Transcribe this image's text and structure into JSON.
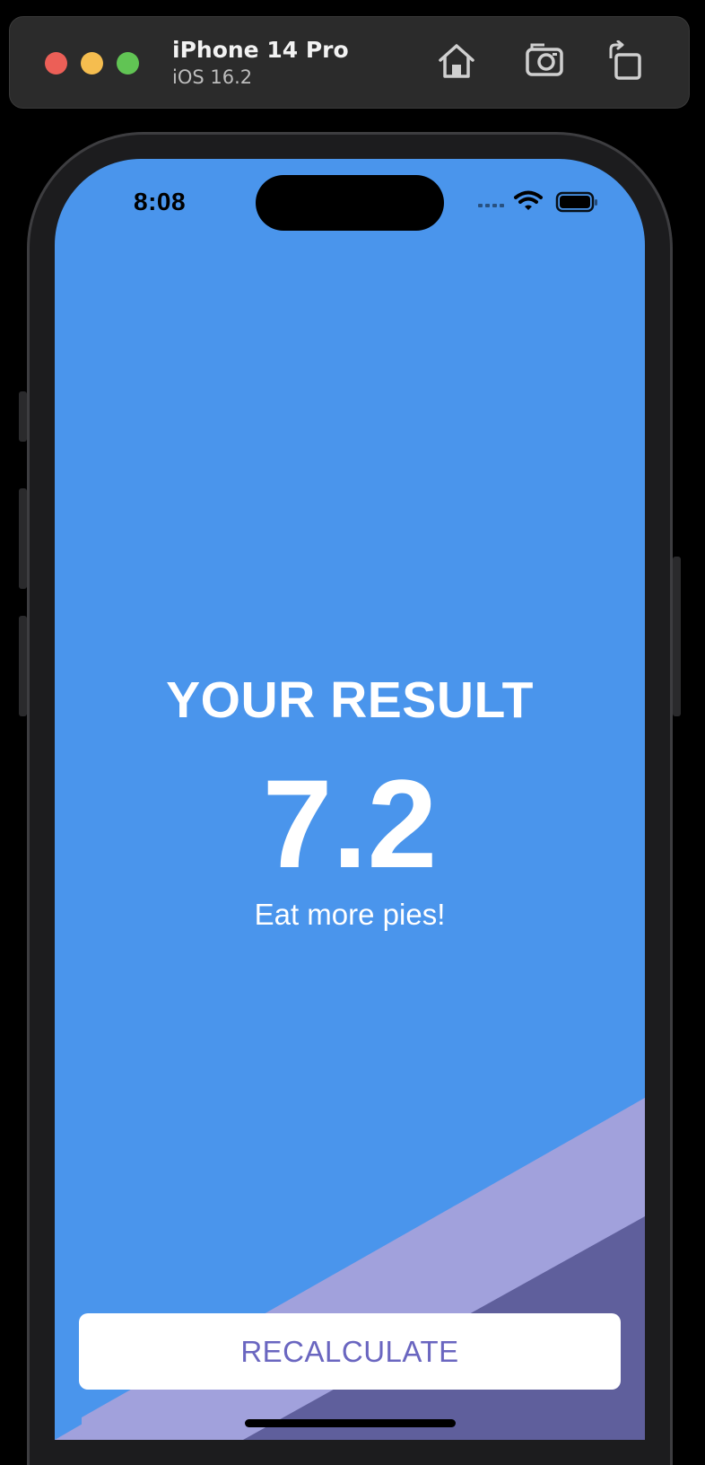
{
  "simulator": {
    "device_name": "iPhone 14 Pro",
    "os_version": "iOS 16.2",
    "buttons": [
      "home-icon",
      "screenshot-icon",
      "rotate-icon"
    ]
  },
  "status_bar": {
    "time": "8:08",
    "icons": [
      "cellular-icon",
      "wifi-icon",
      "battery-icon"
    ]
  },
  "result": {
    "title": "YOUR RESULT",
    "value": "7.2",
    "advice": "Eat more pies!"
  },
  "actions": {
    "recalculate_label": "RECALCULATE"
  },
  "colors": {
    "background": "#4a95ec",
    "stripe_light": "#a1a1dc",
    "stripe_dark": "#5f5f9c",
    "button_text": "#6a66c0"
  }
}
